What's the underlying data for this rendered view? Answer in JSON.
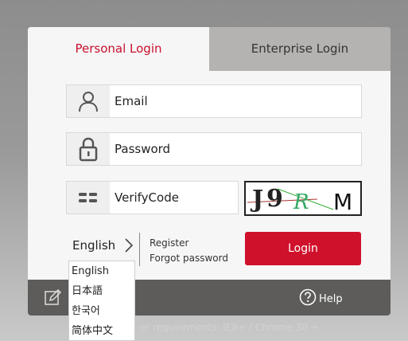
{
  "tabs": {
    "personal": "Personal Login",
    "enterprise": "Enterprise Login"
  },
  "fields": {
    "email": "Email",
    "password": "Password",
    "verifycode": "VerifyCode"
  },
  "captcha": {
    "text": "J9R M"
  },
  "language": {
    "selected": "English",
    "options": [
      "English",
      "日本語",
      "한국어",
      "简体中文"
    ]
  },
  "links": {
    "register": "Register",
    "forgot": "Forgot password"
  },
  "login_button": "Login",
  "footer": {
    "help": "Help"
  },
  "hint": "er requirements: IE8+ / Chrome 30 +",
  "colors": {
    "accent": "#d0112b",
    "tab_active_text": "#c8102e",
    "footer": "#5d5c5b"
  },
  "icons": [
    "user-icon",
    "lock-icon",
    "verifycode-icon",
    "chevron-right-icon",
    "edit-icon",
    "help-icon"
  ]
}
